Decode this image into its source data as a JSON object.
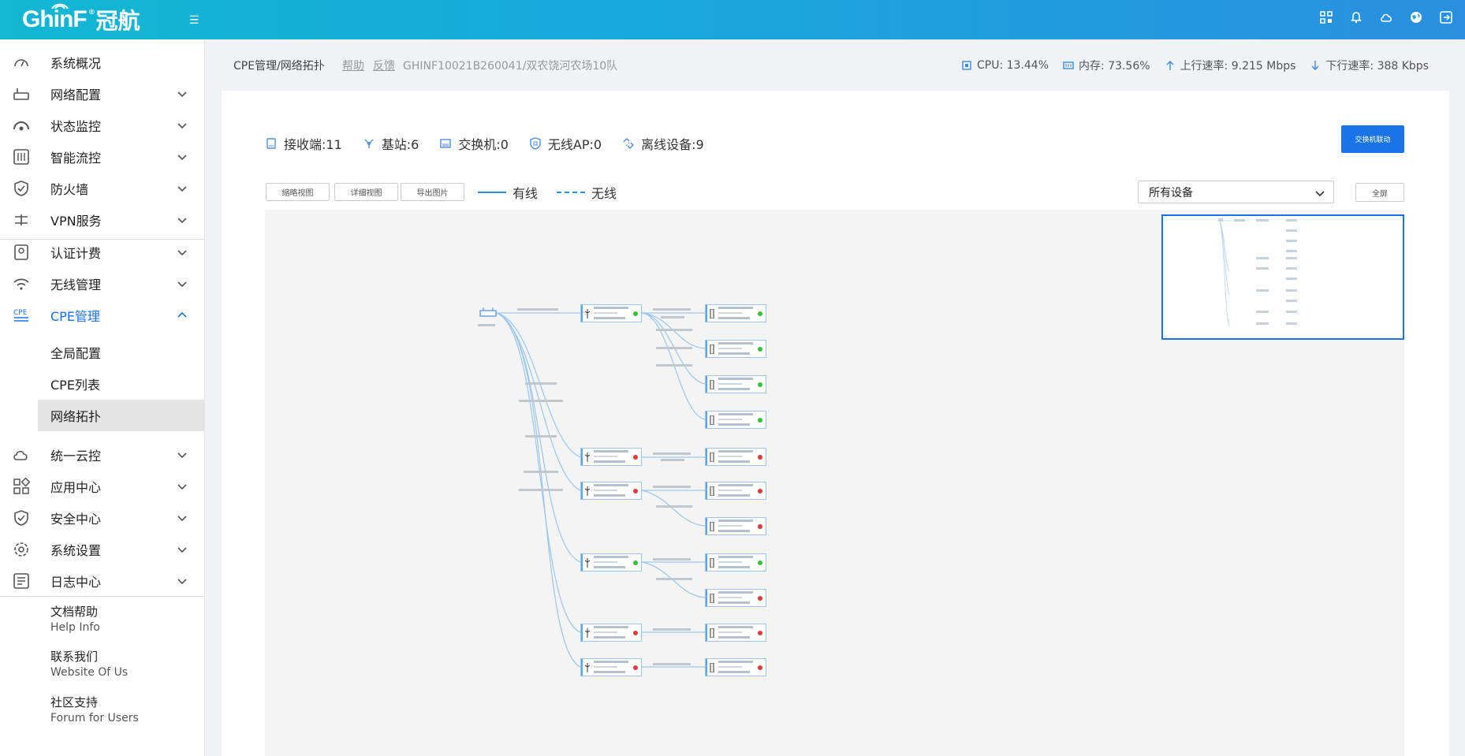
{
  "brand": {
    "logo_text": "GhinF",
    "registered": "®",
    "logo_cn": "冠航",
    "menu_toggle": "☰"
  },
  "sidebar": {
    "items": [
      {
        "label": "系统概况",
        "icon": "dashboard-icon"
      },
      {
        "label": "网络配置",
        "icon": "router-icon"
      },
      {
        "label": "状态监控",
        "icon": "gauge-icon"
      },
      {
        "label": "智能流控",
        "icon": "sliders-icon"
      },
      {
        "label": "防火墙",
        "icon": "shield-icon"
      },
      {
        "label": "VPN服务",
        "icon": "vpn-icon"
      },
      {
        "label": "认证计费",
        "icon": "auth-icon"
      },
      {
        "label": "无线管理",
        "icon": "wifi-icon"
      },
      {
        "label": "CPE管理",
        "icon": "cpe-icon"
      },
      {
        "label": "统一云控",
        "icon": "cloud-icon"
      },
      {
        "label": "应用中心",
        "icon": "apps-icon"
      },
      {
        "label": "安全中心",
        "icon": "security-icon"
      },
      {
        "label": "系统设置",
        "icon": "gear-icon"
      },
      {
        "label": "日志中心",
        "icon": "log-icon"
      }
    ],
    "cpe_sub": [
      "全局配置",
      "CPE列表",
      "网络拓扑"
    ],
    "cpe_icon_text": "CPE",
    "help": [
      {
        "cn": "文档帮助",
        "en": "Help Info"
      },
      {
        "cn": "联系我们",
        "en": "Website Of Us"
      },
      {
        "cn": "社区支持",
        "en": "Forum for Users"
      }
    ]
  },
  "breadcrumb": {
    "path": "CPE管理/网络拓扑",
    "help": "帮助",
    "feedback": "反馈",
    "device": "GHINF10021B260041/双农饶河农场10队"
  },
  "stats": {
    "cpu": "CPU: 13.44%",
    "mem": "内存: 73.56%",
    "up": "上行速率: 9.215 Mbps",
    "down": "下行速率: 388 Kbps"
  },
  "counters": {
    "receivers": "接收端:11",
    "stations": "基站:6",
    "switches": "交换机:0",
    "wireless_ap": "无线AP:0",
    "offline": "离线设备:9"
  },
  "toolbar": {
    "switch_link": "交换机联动",
    "thumb_view": "缩略视图",
    "detail_view": "详细视图",
    "export_image": "导出图片",
    "wired": "有线",
    "wireless": "无线",
    "device_filter": "所有设备",
    "fullscreen": "全屏"
  }
}
